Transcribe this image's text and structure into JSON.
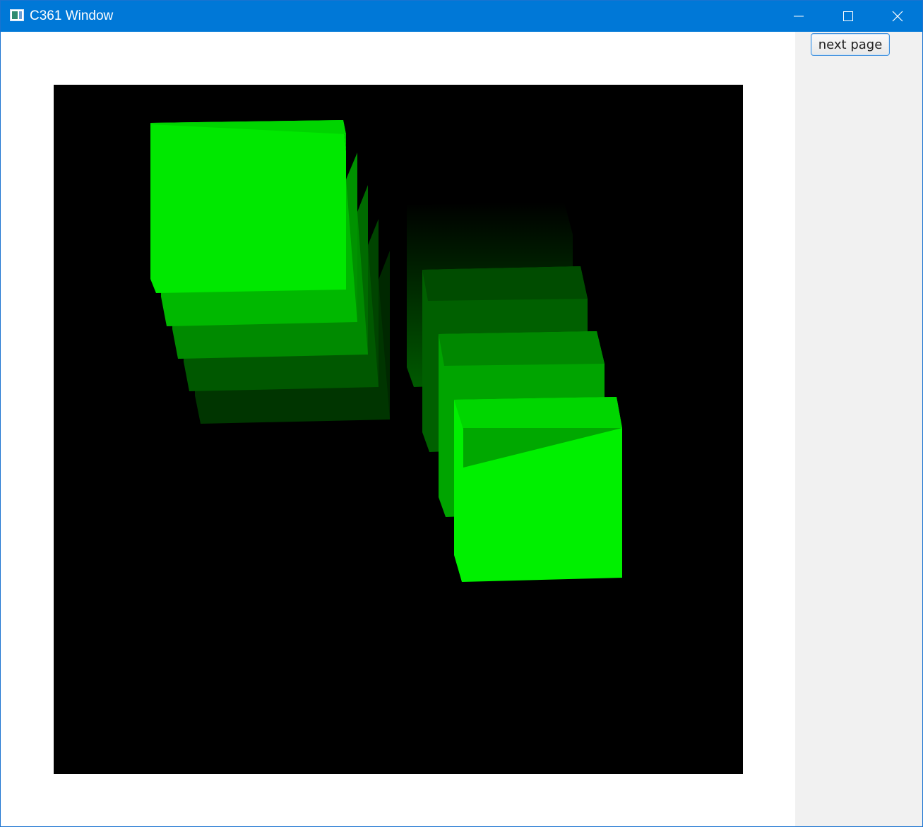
{
  "window": {
    "title": "C361 Window",
    "controls": {
      "minimize_icon": "minimize-icon",
      "maximize_icon": "maximize-icon",
      "close_icon": "close-icon"
    }
  },
  "sidebar": {
    "next_page_label": "next page"
  },
  "scene": {
    "background": "#000000",
    "cube_color": "#00ff00",
    "left_stack_count": 5,
    "right_stack_count": 4
  },
  "colors": {
    "titlebar": "#0078d7",
    "panel": "#f1f1f1"
  }
}
